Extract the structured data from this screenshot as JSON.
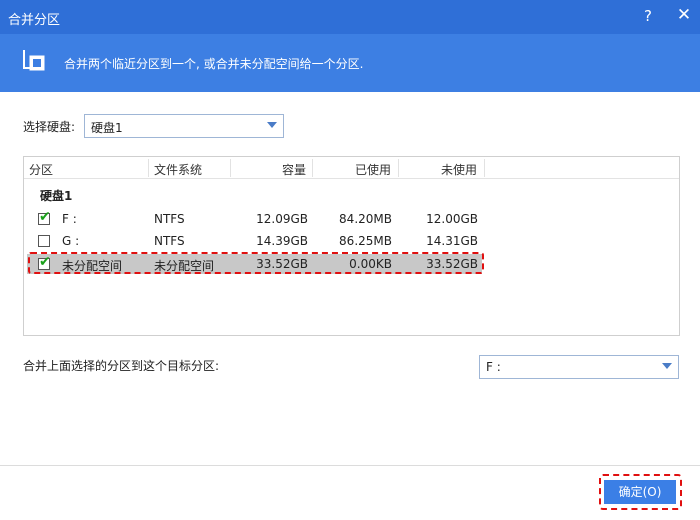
{
  "window": {
    "title": "合并分区",
    "help_glyph": "?",
    "close_glyph": "✕"
  },
  "banner": {
    "text": "合并两个临近分区到一个, 或合并未分配空间给一个分区.",
    "icon": "merge-partition-icon"
  },
  "disk_select": {
    "label": "选择硬盘:",
    "value": "硬盘1"
  },
  "table": {
    "columns": [
      "分区",
      "文件系统",
      "容量",
      "已使用",
      "未使用"
    ],
    "group": "硬盘1",
    "rows": [
      {
        "name": "F :",
        "fs": "NTFS",
        "capacity": "12.09GB",
        "used": "84.20MB",
        "free": "12.00GB",
        "checked": true,
        "selected": false
      },
      {
        "name": "G :",
        "fs": "NTFS",
        "capacity": "14.39GB",
        "used": "86.25MB",
        "free": "14.31GB",
        "checked": false,
        "selected": false
      },
      {
        "name": "未分配空间",
        "fs": "未分配空间",
        "capacity": "33.52GB",
        "used": "0.00KB",
        "free": "33.52GB",
        "checked": true,
        "selected": true
      }
    ]
  },
  "target": {
    "label": "合并上面选择的分区到这个目标分区:",
    "value": "F :"
  },
  "ok_button": {
    "label": "确定(O)"
  },
  "colors": {
    "titlebar": "#2f6fd7",
    "banner": "#3d7fe3",
    "ok_button": "#3b7fe6",
    "highlight": "#e01010",
    "check": "#1aa01a"
  }
}
